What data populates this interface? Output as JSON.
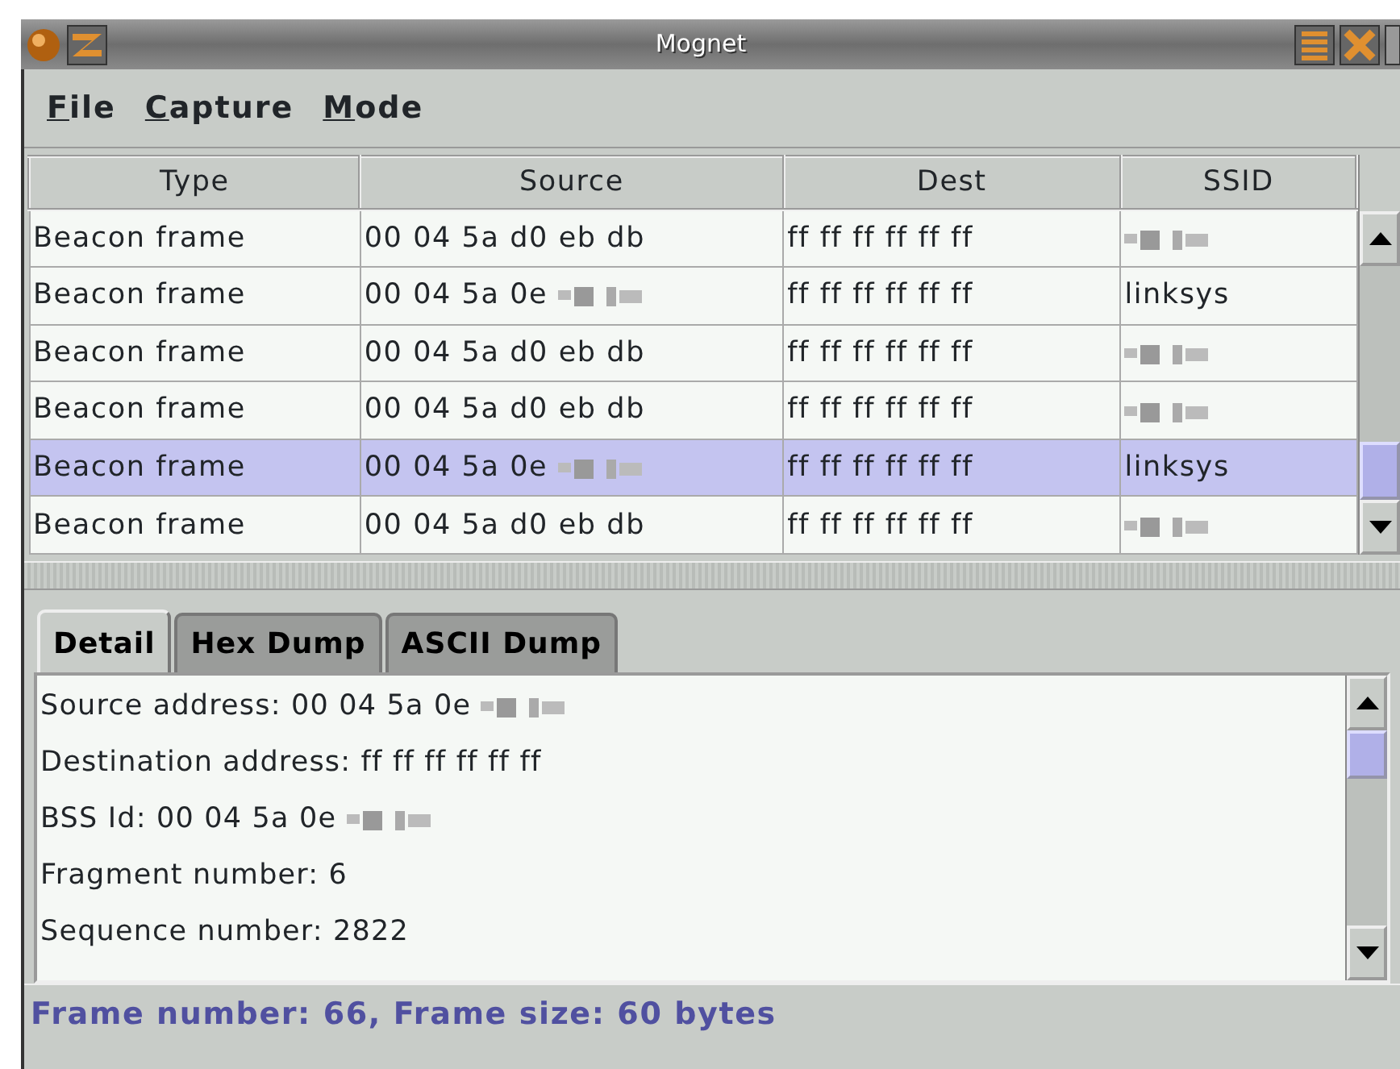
{
  "window": {
    "title": "Mognet"
  },
  "menu": [
    {
      "mnemonic": "F",
      "label_rest": "ile"
    },
    {
      "mnemonic": "C",
      "label_rest": "apture"
    },
    {
      "mnemonic": "M",
      "label_rest": "ode"
    }
  ],
  "table": {
    "columns": [
      "Type",
      "Source",
      "Dest",
      "SSID"
    ],
    "rows": [
      {
        "type": "Beacon frame",
        "source": "00 04 5a d0 eb db",
        "source_redacted": false,
        "dest": "ff ff ff ff ff ff",
        "ssid_redacted": true,
        "selected": false
      },
      {
        "type": "Beacon frame",
        "source": "00 04 5a 0e",
        "source_redacted": true,
        "dest": "ff ff ff ff ff ff",
        "ssid": "linksys",
        "ssid_redacted": false,
        "selected": false
      },
      {
        "type": "Beacon frame",
        "source": "00 04 5a d0 eb db",
        "source_redacted": false,
        "dest": "ff ff ff ff ff ff",
        "ssid_redacted": true,
        "selected": false
      },
      {
        "type": "Beacon frame",
        "source": "00 04 5a d0 eb db",
        "source_redacted": false,
        "dest": "ff ff ff ff ff ff",
        "ssid_redacted": true,
        "selected": false
      },
      {
        "type": "Beacon frame",
        "source": "00 04 5a 0e",
        "source_redacted": true,
        "dest": "ff ff ff ff ff ff",
        "ssid": "linksys",
        "ssid_redacted": false,
        "selected": true
      },
      {
        "type": "Beacon frame",
        "source": "00 04 5a d0 eb db",
        "source_redacted": false,
        "dest": "ff ff ff ff ff ff",
        "ssid_redacted": true,
        "selected": false
      }
    ]
  },
  "tabs": [
    {
      "label": "Detail",
      "selected": true
    },
    {
      "label": "Hex Dump",
      "selected": false
    },
    {
      "label": "ASCII Dump",
      "selected": false
    }
  ],
  "detail": [
    {
      "text": "Source address: 00 04 5a 0e",
      "redacted": true
    },
    {
      "text": "Destination address: ff ff ff ff ff ff",
      "redacted": false
    },
    {
      "text": "BSS Id: 00 04 5a 0e",
      "redacted": true
    },
    {
      "text": "Fragment number: 6",
      "redacted": false
    },
    {
      "text": "Sequence number: 2822",
      "redacted": false
    }
  ],
  "status_bar": "Frame number: 66, Frame size: 60 bytes"
}
